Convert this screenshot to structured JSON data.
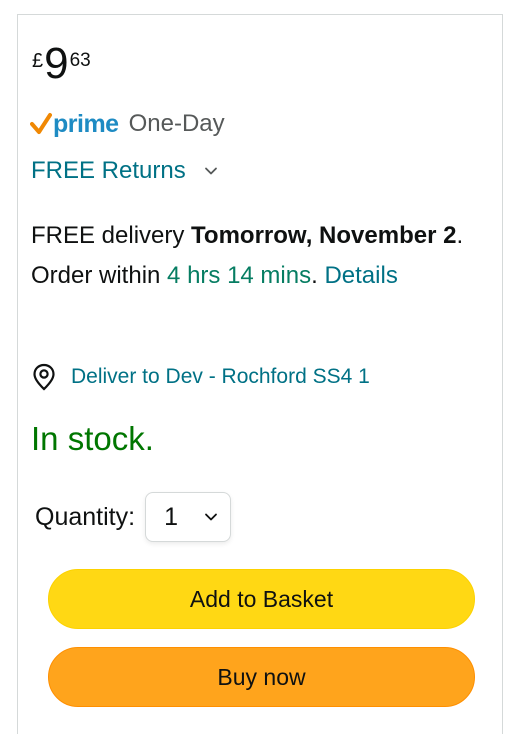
{
  "price": {
    "currency_symbol": "£",
    "whole": "9",
    "fraction": "63"
  },
  "prime": {
    "logo_text": "prime",
    "service": "One-Day",
    "check_color": "#f08804",
    "word_color": "#1e8bc3",
    "icon": "prime-check-icon"
  },
  "returns": {
    "label": "FREE Returns",
    "icon": "chevron-down-icon"
  },
  "delivery": {
    "prefix": "FREE delivery ",
    "date": "Tomorrow, November 2",
    "order_within": ". Order within ",
    "countdown": "4 hrs 14 mins",
    "period": ". ",
    "details_link": "Details"
  },
  "deliver_to": {
    "label": "Deliver to Dev - Rochford SS4 1",
    "icon": "location-pin-icon"
  },
  "stock": {
    "status": "In stock.",
    "color": "#007600"
  },
  "quantity": {
    "label": "Quantity:",
    "selected": "1",
    "icon": "chevron-down-icon"
  },
  "buttons": {
    "add_to_basket": "Add to Basket",
    "buy_now": "Buy now",
    "basket_color": "#ffd814",
    "buy_color": "#ffa41c"
  },
  "colors": {
    "link": "#007185",
    "green_text": "#067d62"
  }
}
